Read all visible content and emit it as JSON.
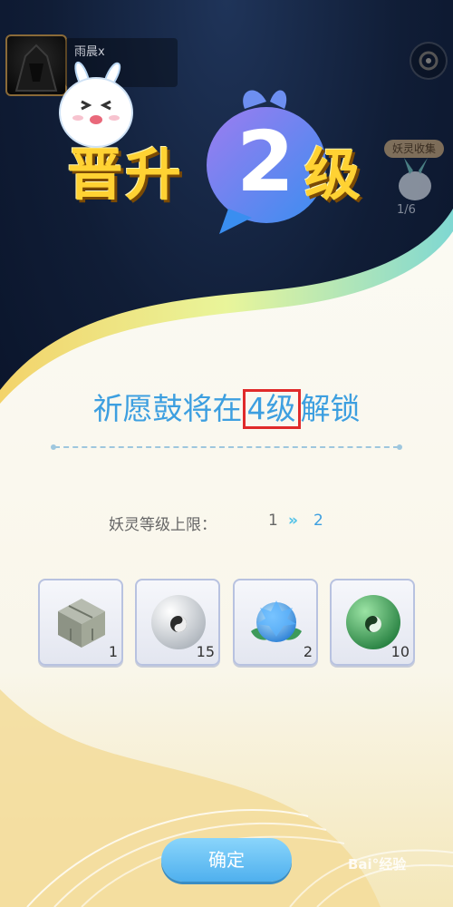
{
  "player": {
    "name": "雨晨x"
  },
  "collection": {
    "label": "妖灵收集",
    "count": "1/6"
  },
  "levelup": {
    "prefix": "晋升",
    "level": "2",
    "suffix": "级"
  },
  "unlock": {
    "before": "祈愿鼓将在",
    "highlight": "4级",
    "after": "解锁"
  },
  "level_cap": {
    "label": "妖灵等级上限：",
    "from": "1",
    "arrow": "»",
    "to": "2"
  },
  "rewards": [
    {
      "icon": "stone-cube-icon",
      "count": "1"
    },
    {
      "icon": "white-yinyang-orb-icon",
      "count": "15"
    },
    {
      "icon": "blue-lotus-gem-icon",
      "count": "2"
    },
    {
      "icon": "green-yinyang-orb-icon",
      "count": "10"
    }
  ],
  "confirm_button": {
    "label": "确定"
  },
  "watermark": {
    "text": "Bai°经验"
  },
  "colors": {
    "accent_blue": "#3d9fe0",
    "title_yellow": "#ffd233",
    "highlight_border": "#e02a2a",
    "button_blue": "#4fb0ee"
  }
}
